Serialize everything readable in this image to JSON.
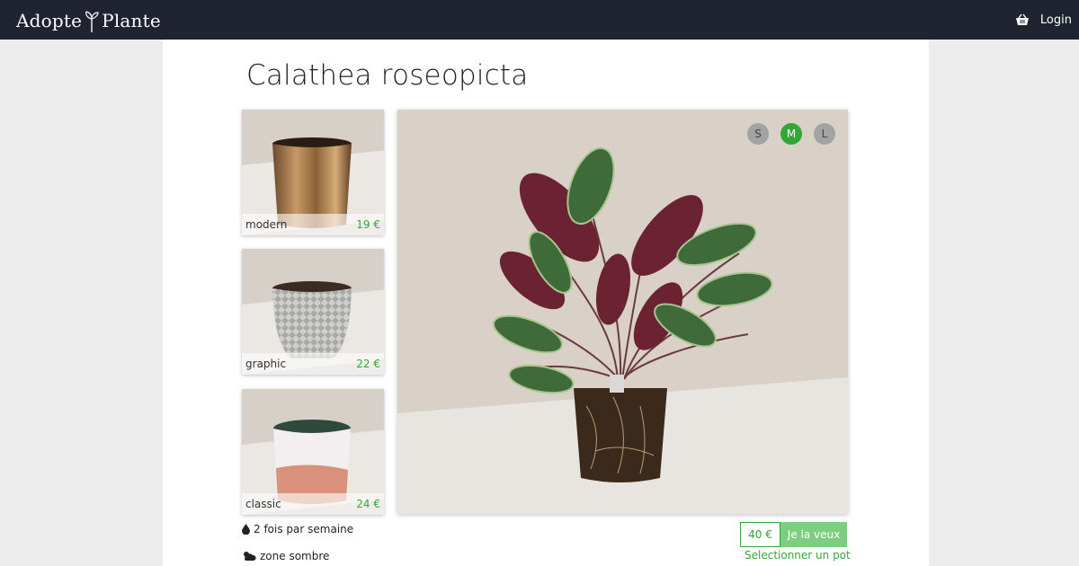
{
  "brand": {
    "name_part1": "Adopte",
    "name_part2": "Plante"
  },
  "nav": {
    "login_label": "Login",
    "basket_icon": "basket-icon"
  },
  "product": {
    "title": "Calathea roseopicta",
    "sizes": [
      {
        "label": "S",
        "selected": false
      },
      {
        "label": "M",
        "selected": true
      },
      {
        "label": "L",
        "selected": false
      }
    ],
    "price": "40 €",
    "cta_label": "Je la veux",
    "select_pot_label": "Selectionner un pot"
  },
  "pots": [
    {
      "name": "modern",
      "price": "19 €"
    },
    {
      "name": "graphic",
      "price": "22 €"
    },
    {
      "name": "classic",
      "price": "24 €"
    }
  ],
  "care": {
    "water": "2 fois par semaine",
    "light": "zone sombre"
  },
  "colors": {
    "accent": "#2fa837",
    "navbar": "#1f2430",
    "cta_bg": "#7dce7f"
  }
}
